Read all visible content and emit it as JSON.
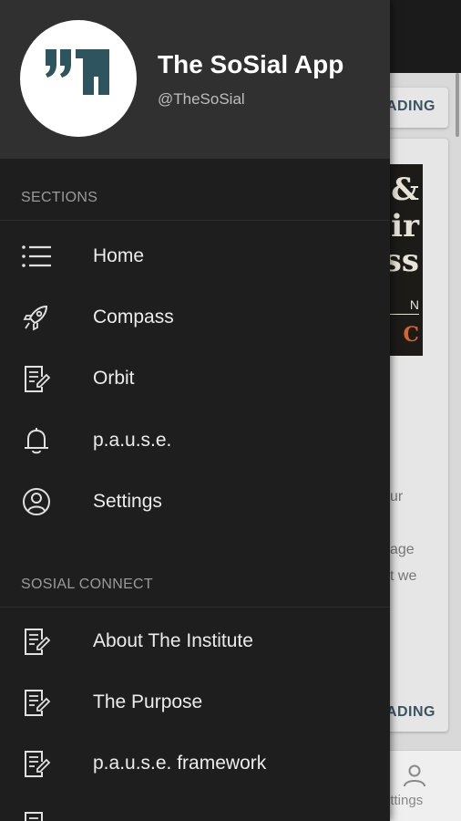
{
  "drawer": {
    "app_title": "The SoSial App",
    "app_handle": "@TheSoSial",
    "sections": [
      {
        "header": "SECTIONS",
        "items": [
          {
            "label": "Home",
            "icon": "list-icon"
          },
          {
            "label": "Compass",
            "icon": "rocket-icon"
          },
          {
            "label": "Orbit",
            "icon": "edit-note-icon"
          },
          {
            "label": "p.a.u.s.e.",
            "icon": "bell-icon"
          },
          {
            "label": "Settings",
            "icon": "user-circle-icon"
          }
        ]
      },
      {
        "header": "SOSIAL CONNECT",
        "items": [
          {
            "label": "About The Institute",
            "icon": "edit-note-icon"
          },
          {
            "label": "The Purpose",
            "icon": "edit-note-icon"
          },
          {
            "label": "p.a.u.s.e. framework",
            "icon": "edit-note-icon"
          }
        ]
      }
    ]
  },
  "background": {
    "button_top": "ADING",
    "image_lines": [
      "&",
      "ir",
      "ss",
      "N",
      "C"
    ],
    "text_lines": [
      "ur",
      "age",
      "t we"
    ],
    "button_bottom": "ADING",
    "nav_label": "ettings"
  },
  "colors": {
    "drawer_bg": "#1e1e1e",
    "header_bg": "#303030",
    "logo_teal": "#2e5460"
  }
}
